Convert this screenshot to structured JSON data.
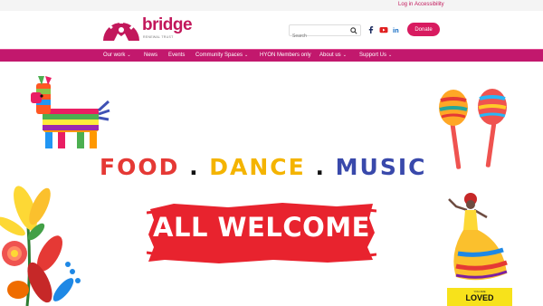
{
  "util": {
    "login": "Log in",
    "accessibility": "Accessibility"
  },
  "brand": {
    "name": "bridge",
    "tagline": "RENEWAL TRUST",
    "color": "#c2185b"
  },
  "search": {
    "placeholder": "Search"
  },
  "icons": [
    "search-icon",
    "facebook-icon",
    "youtube-icon",
    "linkedin-icon",
    "chevron-down-icon"
  ],
  "donate": "Donate",
  "nav": {
    "our_work": "Our work",
    "news": "News",
    "events": "Events",
    "community": "Community Spaces",
    "hyon": "HYON Members only",
    "about": "About us",
    "support": "Support Us",
    "chevron": "⌄"
  },
  "hero": {
    "food": "FOOD",
    "dance": "DANCE",
    "music": "MUSIC",
    "dot": ".",
    "welcome": "ALL WELCOME",
    "badge_top": "YOU ARE",
    "badge_main": "LOVED"
  },
  "colors": {
    "nav": "#c2186d",
    "donate": "#d81b60",
    "food": "#e53935",
    "dance": "#f4b400",
    "music": "#3949ab",
    "banner": "#e8232e"
  }
}
